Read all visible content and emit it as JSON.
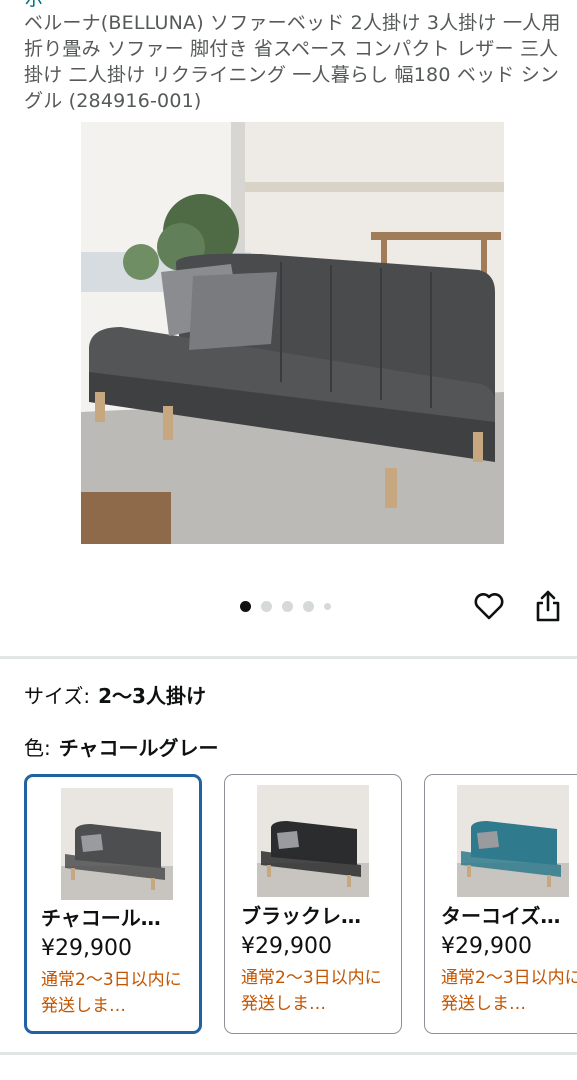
{
  "header": {
    "store_link": "ホ",
    "product_title": "ベルーナ(BELLUNA) ソファーベッド 2人掛け 3人掛け 一人用 折り畳み ソファー 脚付き 省スペース コンパクト レザー 三人掛け 二人掛け リクライニング 一人暮らし 幅180 ベッド シングル (284916-001)"
  },
  "gallery": {
    "image_count": 5,
    "active_index": 0,
    "icons": {
      "favorite": "heart-icon",
      "share": "share-icon"
    }
  },
  "variations": {
    "size_label": "サイズ:",
    "size_value": "2〜3人掛け",
    "color_label": "色:",
    "color_value": "チャコールグレー",
    "swatches": [
      {
        "name": "チャコール…",
        "price": "¥29,900",
        "delivery": "通常2〜3日以内に発送しま…",
        "selected": true,
        "sofa_color": "#4d4e50"
      },
      {
        "name": "ブラックレ…",
        "price": "¥29,900",
        "delivery": "通常2〜3日以内に発送しま…",
        "selected": false,
        "sofa_color": "#2b2c2e"
      },
      {
        "name": "ターコイズ…",
        "price": "¥29,900",
        "delivery": "通常2〜3日以内に発送しま…",
        "selected": false,
        "sofa_color": "#2f7a8c"
      }
    ]
  },
  "colors": {
    "link": "#007185",
    "selected_border": "#2162a1",
    "delivery_text": "#c45500"
  }
}
